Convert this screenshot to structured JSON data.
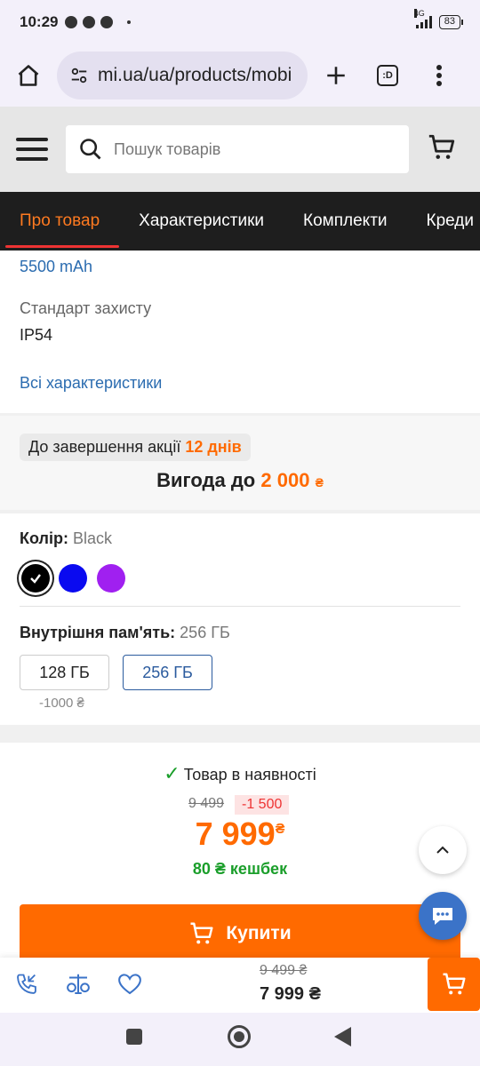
{
  "status_bar": {
    "time": "10:29",
    "network": "4G",
    "battery": "83"
  },
  "browser": {
    "url": "mi.ua/ua/products/mobi",
    "tab_count": ":D"
  },
  "header": {
    "search_placeholder": "Пошук товарів"
  },
  "tabs": [
    {
      "label": "Про товар",
      "active": true
    },
    {
      "label": "Характеристики",
      "active": false
    },
    {
      "label": "Комплекти",
      "active": false
    },
    {
      "label": "Креди",
      "active": false
    }
  ],
  "specs": {
    "battery_value": "5500 mAh",
    "protection_label": "Стандарт захисту",
    "protection_value": "IP54",
    "all_specs_link": "Всі характеристики"
  },
  "promo": {
    "ends_label": "До завершення акції",
    "ends_value": "12 днів",
    "benefit_label": "Вигода до",
    "benefit_value": "2 000",
    "currency": "₴"
  },
  "color": {
    "label": "Колір:",
    "selected": "Black",
    "swatches": [
      {
        "name": "Black",
        "hex": "#000000",
        "selected": true
      },
      {
        "name": "Blue",
        "hex": "#0a0af0",
        "selected": false
      },
      {
        "name": "Purple",
        "hex": "#a020f0",
        "selected": false
      }
    ]
  },
  "memory": {
    "label": "Внутрішня пам'ять:",
    "selected": "256 ГБ",
    "options": [
      {
        "label": "128 ГБ",
        "note": "-1000 ₴",
        "selected": false
      },
      {
        "label": "256 ГБ",
        "note": "",
        "selected": true
      }
    ]
  },
  "purchase": {
    "stock_text": "Товар в наявності",
    "old_price": "9 499",
    "discount": "-1 500",
    "new_price": "7 999",
    "currency": "₴",
    "cashback": "80 ₴ кешбек",
    "buy_label": "Купити"
  },
  "bottom_bar": {
    "old_price": "9 499 ₴",
    "new_price": "7 999 ₴"
  },
  "colors": {
    "accent": "#ff6a00",
    "link": "#2b6cb0",
    "success": "#1a9e2a",
    "danger": "#ee3333"
  }
}
